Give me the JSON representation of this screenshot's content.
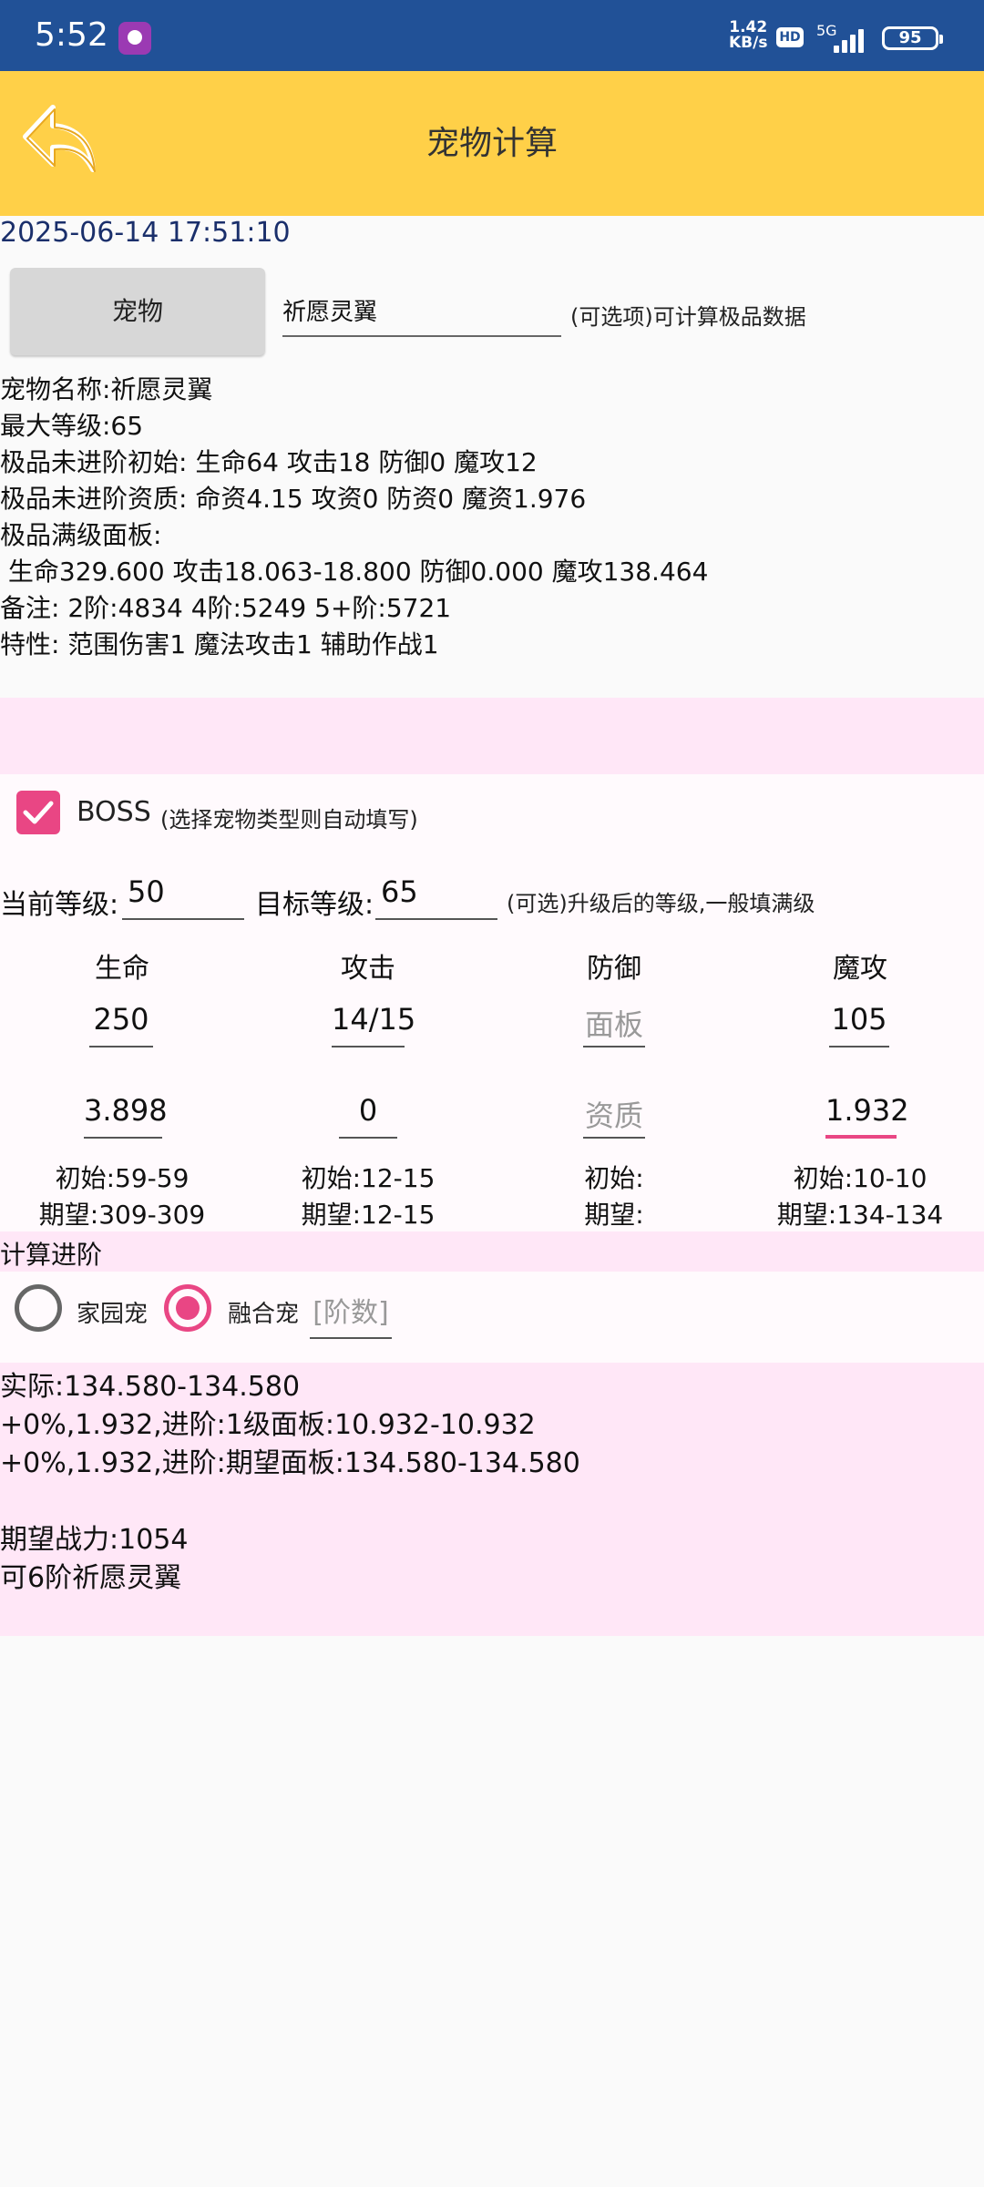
{
  "status_bar": {
    "time": "5:52",
    "speed_value": "1.42",
    "speed_unit": "KB/s",
    "hd": "HD",
    "network": "5G",
    "battery": "95"
  },
  "header": {
    "title": "宠物计算",
    "back_icon": "back-arrow-icon"
  },
  "timestamp": "2025-06-14 17:51:10",
  "pet_select": {
    "button_label": "宠物",
    "input_value": "祈愿灵翼",
    "hint": "(可选项)可计算极品数据"
  },
  "info_lines": [
    "宠物名称:祈愿灵翼",
    "最大等级:65",
    "极品未进阶初始: 生命64 攻击18 防御0 魔攻12",
    "极品未进阶资质: 命资4.15 攻资0 防资0 魔资1.976",
    "极品满级面板:",
    " 生命329.600 攻击18.063-18.800 防御0.000 魔攻138.464",
    "备注: 2阶:4834 4阶:5249 5+阶:5721",
    "特性: 范围伤害1 魔法攻击1 辅助作战1"
  ],
  "boss": {
    "checked": true,
    "label": "BOSS",
    "hint": "(选择宠物类型则自动填写)"
  },
  "level": {
    "current_label": "当前等级:",
    "current_value": "50",
    "target_label": "目标等级:",
    "target_value": "65",
    "hint": "(可选)升级后的等级,一般填满级"
  },
  "stats": {
    "headers": [
      "生命",
      "攻击",
      "防御",
      "魔攻"
    ],
    "panel": [
      "250",
      "14/15",
      "",
      "105"
    ],
    "panel_placeholder": "面板",
    "aptitude": [
      "3.898",
      "0",
      "",
      "1.932"
    ],
    "aptitude_placeholder": "资质",
    "initial": [
      "初始:59-59",
      "初始:12-15",
      "初始:",
      "初始:10-10"
    ],
    "expected": [
      "期望:309-309",
      "期望:12-15",
      "期望:",
      "期望:134-134"
    ]
  },
  "advance": {
    "label": "计算进阶",
    "radio_home": "家园宠",
    "radio_fusion": "融合宠",
    "selected": "融合宠",
    "stage_placeholder": "[阶数]"
  },
  "result_lines": [
    "实际:134.580-134.580",
    "+0%,1.932,进阶:1级面板:10.932-10.932",
    "+0%,1.932,进阶:期望面板:134.580-134.580",
    "",
    "期望战力:1054",
    "可6阶祈愿灵翼"
  ]
}
